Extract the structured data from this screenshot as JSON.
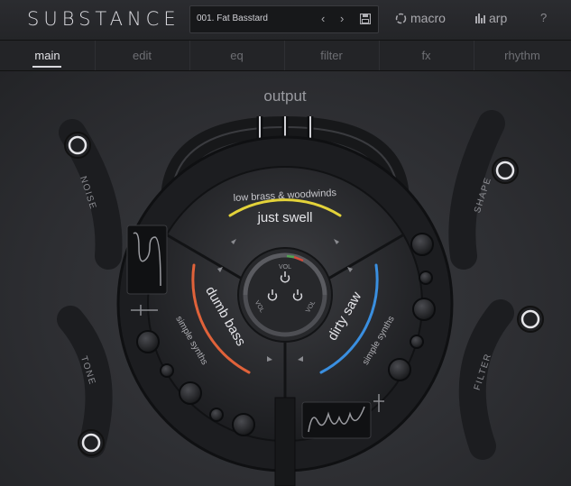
{
  "logo": "SUBSTANCE",
  "preset": {
    "name": "001. Fat Basstard",
    "prev": "‹",
    "next": "›"
  },
  "header": {
    "macro": "macro",
    "arp": "arp",
    "help": "?"
  },
  "tabs": [
    "main",
    "edit",
    "eq",
    "filter",
    "fx",
    "rhythm"
  ],
  "active_tab": "main",
  "output_label": "output",
  "side_controls": {
    "noise": "NOISE",
    "tone": "TONE",
    "shape": "SHAPE",
    "filter": "FILTER"
  },
  "layers": {
    "top": {
      "category": "low brass & woodwinds",
      "name": "just swell",
      "color": "#e3d23a"
    },
    "left": {
      "category": "simple synths",
      "name": "dumb bass",
      "color": "#e0623a"
    },
    "right": {
      "category": "simple synths",
      "name": "dirty saw",
      "color": "#3a8fe0"
    }
  },
  "vol_label": "VOL",
  "power_icon": "power-icon"
}
